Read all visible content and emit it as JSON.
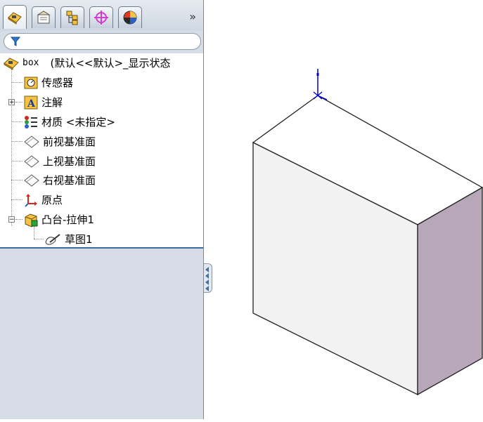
{
  "tabs": [
    {
      "name": "feature-manager-tab",
      "icon": "feature-manager-icon",
      "active": true
    },
    {
      "name": "property-manager-tab",
      "icon": "property-manager-icon",
      "active": false
    },
    {
      "name": "configuration-manager-tab",
      "icon": "configuration-manager-icon",
      "active": false
    },
    {
      "name": "dimxpert-manager-tab",
      "icon": "dimxpert-icon",
      "active": false
    },
    {
      "name": "display-manager-tab",
      "icon": "display-manager-icon",
      "active": false
    }
  ],
  "more_tabs_label": "»",
  "filter": {
    "icon": "filter-icon"
  },
  "tree": {
    "root": {
      "name": "box",
      "config": "(默认<<默认>_显示状态",
      "icon": "part-icon"
    },
    "items": [
      {
        "label": "传感器",
        "icon": "sensor-icon"
      },
      {
        "label": "注解",
        "icon": "annotation-icon",
        "expander": "+"
      },
      {
        "label": "材质 <未指定>",
        "icon": "material-icon"
      },
      {
        "label": "前视基准面",
        "icon": "plane-icon"
      },
      {
        "label": "上视基准面",
        "icon": "plane-icon"
      },
      {
        "label": "右视基准面",
        "icon": "plane-icon"
      },
      {
        "label": "原点",
        "icon": "origin-icon"
      },
      {
        "label": "凸台-拉伸1",
        "icon": "extrude-icon",
        "expander": "−"
      },
      {
        "label": "草图1",
        "icon": "sketch-icon"
      }
    ]
  },
  "colors": {
    "panel_bg": "#d6dde6",
    "model_front": "#f3f3f3",
    "model_top": "#ffffff",
    "model_side": "#b9a9b9",
    "origin_blue": "#0000cc"
  }
}
